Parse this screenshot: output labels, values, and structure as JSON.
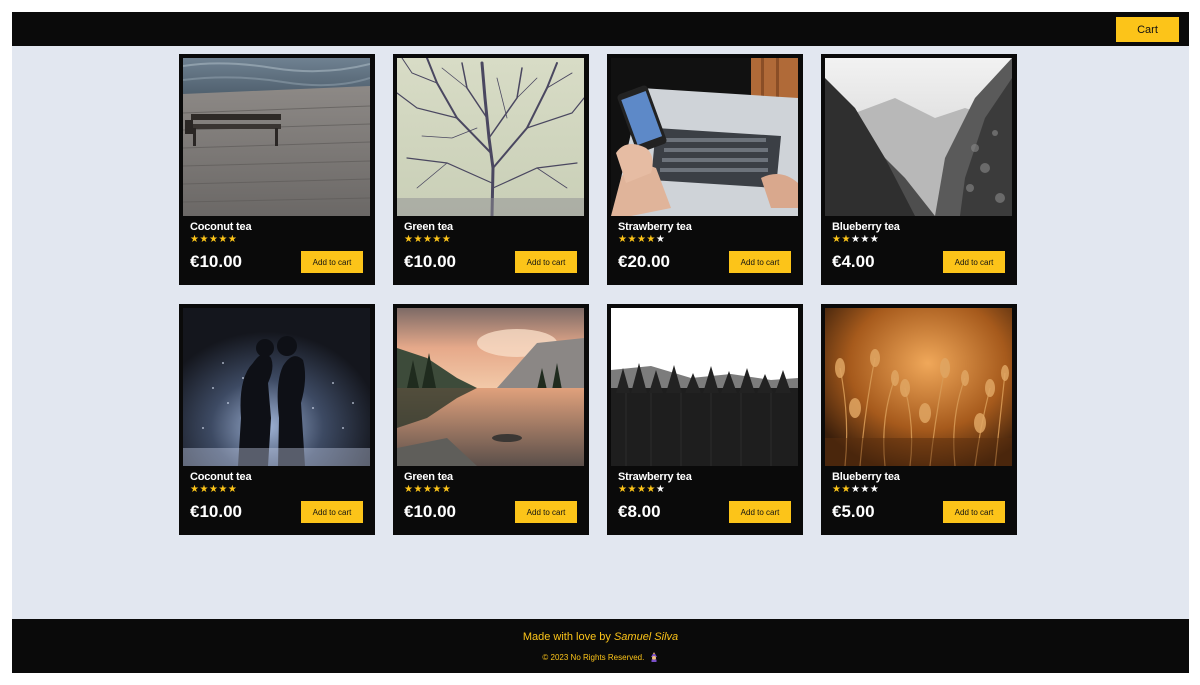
{
  "header": {
    "cart_label": "Cart"
  },
  "products": [
    {
      "name": "Coconut tea",
      "rating": 5,
      "price": "€10.00",
      "button": "Add to cart",
      "image": "pier-bench-photo"
    },
    {
      "name": "Green tea",
      "rating": 5,
      "price": "€10.00",
      "button": "Add to cart",
      "image": "bare-tree-photo"
    },
    {
      "name": "Strawberry tea",
      "rating": 4,
      "price": "€20.00",
      "button": "Add to cart",
      "image": "phone-laptop-photo"
    },
    {
      "name": "Blueberry tea",
      "rating": 2,
      "price": "€4.00",
      "button": "Add to cart",
      "image": "misty-valley-photo"
    },
    {
      "name": "Coconut tea",
      "rating": 5,
      "price": "€10.00",
      "button": "Add to cart",
      "image": "couple-rain-photo"
    },
    {
      "name": "Green tea",
      "rating": 5,
      "price": "€10.00",
      "button": "Add to cart",
      "image": "mountain-lake-photo"
    },
    {
      "name": "Strawberry tea",
      "rating": 4,
      "price": "€8.00",
      "button": "Add to cart",
      "image": "forest-treeline-photo"
    },
    {
      "name": "Blueberry tea",
      "rating": 2,
      "price": "€5.00",
      "button": "Add to cart",
      "image": "golden-grass-photo"
    }
  ],
  "stars_total": 5,
  "colors": {
    "accent": "#fcc419",
    "dark": "#0a0a0a",
    "background": "#e2e7f0"
  },
  "footer": {
    "made_with": "Made with love by",
    "author": "Samuel Silva",
    "copyright": "© 2023 No Rights Reserved.",
    "emoji_icon": "wizard-emoji-icon"
  }
}
